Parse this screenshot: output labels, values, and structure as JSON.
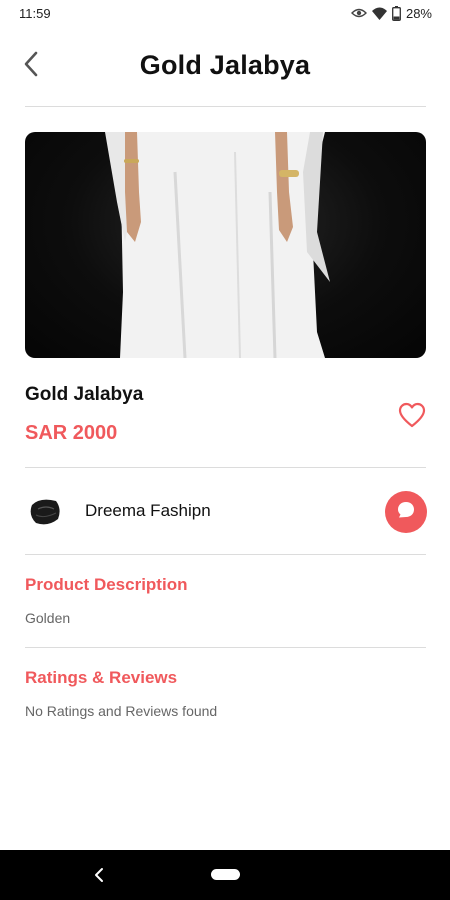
{
  "status_bar": {
    "time": "11:59",
    "battery": "28%",
    "icons": [
      "eye-icon",
      "wifi-icon",
      "battery-icon"
    ]
  },
  "header": {
    "title": "Gold Jalabya",
    "back_icon": "chevron-left-icon"
  },
  "product": {
    "image_description": "product-photo",
    "name": "Gold Jalabya",
    "price": "SAR 2000",
    "favorite_icon": "heart-outline-icon"
  },
  "seller": {
    "name": "Dreema Fashipn",
    "chat_icon": "chat-bubble-icon"
  },
  "description": {
    "title": "Product Description",
    "text": "Golden"
  },
  "reviews": {
    "title": "Ratings & Reviews",
    "text": "No Ratings and Reviews found"
  },
  "colors": {
    "accent": "#f0595c",
    "text": "#111111",
    "muted": "#666666",
    "divider": "#dcdcdc"
  }
}
